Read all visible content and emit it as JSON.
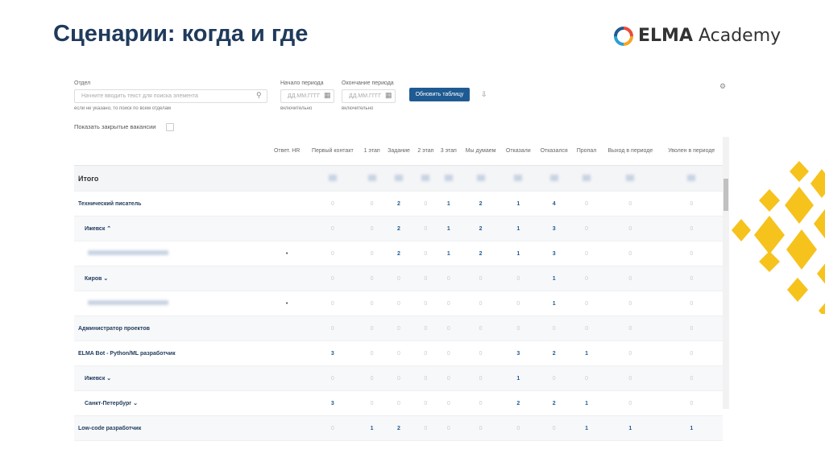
{
  "title": "Сценарии: когда и где",
  "logo": {
    "brand": "ELMA",
    "suffix": "Academy"
  },
  "filters": {
    "department_label": "Отдел",
    "department_placeholder": "Начните вводить текст для поиска элемента",
    "department_hint": "если не указано, то поиск по всем отделам",
    "start_label": "Начало периода",
    "start_placeholder": "ДД.ММ.ГГГГ",
    "start_hint": "включительно",
    "end_label": "Окончание периода",
    "end_placeholder": "ДД.ММ.ГГГГ",
    "end_hint": "включительно",
    "refresh_button": "Обновить таблицу",
    "show_closed_label": "Показать закрытые вакансии"
  },
  "table": {
    "columns": [
      "Ответ. HR",
      "Первый контакт",
      "1 этап",
      "Задание",
      "2 этап",
      "3 этап",
      "Мы думаем",
      "Отказали",
      "Отказался",
      "Пропал",
      "Выход в периоде",
      "Уволен в периоде"
    ],
    "total_label": "Итого",
    "rows": [
      {
        "name": "Технический писатель",
        "level": 0,
        "hr": "",
        "values": [
          0,
          0,
          2,
          0,
          1,
          2,
          1,
          4,
          0,
          0,
          0
        ]
      },
      {
        "name": "Ижевск ⌃",
        "level": 1,
        "hr": "",
        "values": [
          0,
          0,
          2,
          0,
          1,
          2,
          1,
          3,
          0,
          0,
          0
        ]
      },
      {
        "name": "",
        "level": 2,
        "hr": "•",
        "values": [
          0,
          0,
          2,
          0,
          1,
          2,
          1,
          3,
          0,
          0,
          0
        ]
      },
      {
        "name": "Киров ⌄",
        "level": 1,
        "hr": "",
        "values": [
          0,
          0,
          0,
          0,
          0,
          0,
          0,
          1,
          0,
          0,
          0
        ]
      },
      {
        "name": "",
        "level": 2,
        "hr": "•",
        "values": [
          0,
          0,
          0,
          0,
          0,
          0,
          0,
          1,
          0,
          0,
          0
        ]
      },
      {
        "name": "Администратор проектов",
        "level": 0,
        "hr": "",
        "values": [
          0,
          0,
          0,
          0,
          0,
          0,
          0,
          0,
          0,
          0,
          0
        ]
      },
      {
        "name": "ELMA Bot - Python/ML разработчик",
        "level": 0,
        "hr": "",
        "values": [
          3,
          0,
          0,
          0,
          0,
          0,
          3,
          2,
          1,
          0,
          0
        ]
      },
      {
        "name": "Ижевск ⌄",
        "level": 1,
        "hr": "",
        "values": [
          0,
          0,
          0,
          0,
          0,
          0,
          1,
          0,
          0,
          0,
          0
        ]
      },
      {
        "name": "Санкт-Петербург ⌄",
        "level": 1,
        "hr": "",
        "values": [
          3,
          0,
          0,
          0,
          0,
          0,
          2,
          2,
          1,
          0,
          0
        ]
      },
      {
        "name": "Low-code разработчик",
        "level": 0,
        "hr": "",
        "values": [
          0,
          1,
          2,
          0,
          0,
          0,
          0,
          0,
          1,
          1,
          1
        ]
      }
    ]
  },
  "colors": {
    "accent": "#1f5b92",
    "title": "#1f3a5c",
    "decor": "#f6c21c"
  }
}
